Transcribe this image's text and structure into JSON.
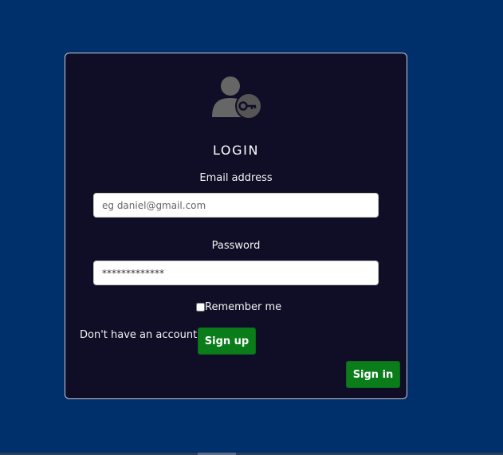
{
  "login": {
    "title": "LOGIN",
    "email_label": "Email address",
    "email_placeholder": "eg daniel@gmail.com",
    "password_label": "Password",
    "password_value": "*************",
    "remember_label": "Remember me",
    "remember_checked": false,
    "no_account_text": "Don't have an account?",
    "signup_label": "Sign up",
    "signin_label": "Sign in"
  },
  "icons": {
    "avatar": "user-key-icon"
  },
  "colors": {
    "page_background": "#00306b",
    "card_background": "#100e27",
    "button_green": "#0a7d1a"
  }
}
